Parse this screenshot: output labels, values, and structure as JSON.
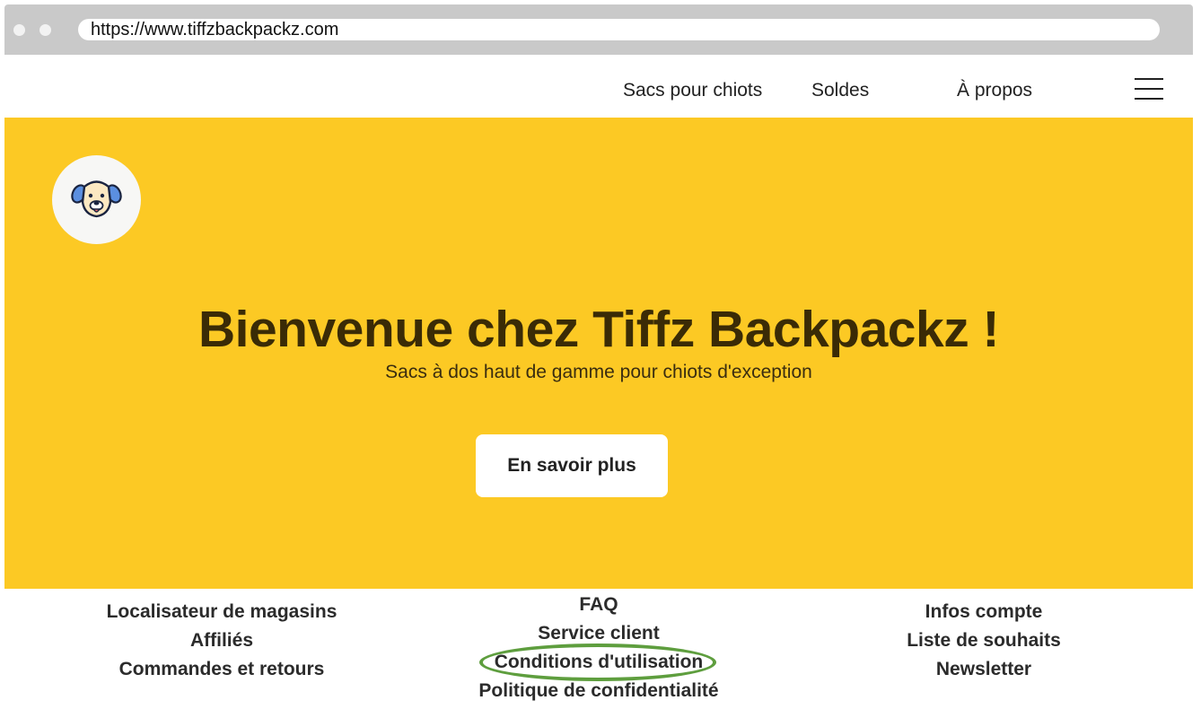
{
  "browser": {
    "url": "https://www.tiffzbackpackz.com"
  },
  "nav": {
    "items": [
      "Sacs pour chiots",
      "Soldes",
      "À propos"
    ],
    "menu_icon": "hamburger-menu-icon"
  },
  "hero": {
    "logo_icon": "dog-face-icon",
    "title": "Bienvenue chez Tiffz Backpackz !",
    "subtitle": "Sacs à dos haut de gamme pour chiots d'exception",
    "button_label": "En savoir plus",
    "background_color": "#fcc924"
  },
  "footer": {
    "col1": [
      "Localisateur de magasins",
      "Affiliés",
      "Commandes et retours"
    ],
    "col2": [
      "FAQ",
      "Service client",
      "Conditions d'utilisation",
      "Politique de confidentialité"
    ],
    "col3": [
      "Infos compte",
      "Liste de souhaits",
      "Newsletter"
    ],
    "highlighted_link": "Conditions d'utilisation",
    "highlight_color": "#5e9e3e"
  }
}
